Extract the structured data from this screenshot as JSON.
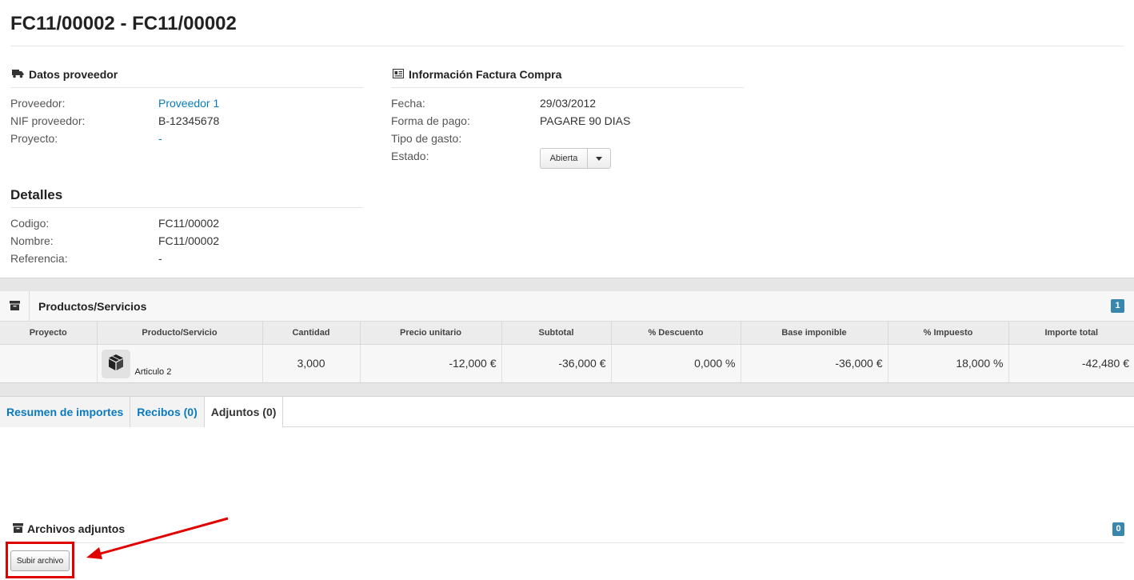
{
  "page": {
    "title": "FC11/00002 - FC11/00002"
  },
  "supplier": {
    "heading": "Datos proveedor",
    "icon": "truck-icon",
    "fields": [
      {
        "label": "Proveedor:",
        "value": "Proveedor 1",
        "link": true
      },
      {
        "label": "NIF proveedor:",
        "value": "B-12345678",
        "link": false
      },
      {
        "label": "Proyecto:",
        "value": "-",
        "link": true
      }
    ]
  },
  "invoice": {
    "heading": "Información Factura Compra",
    "icon": "id-card-icon",
    "fields": [
      {
        "label": "Fecha:",
        "value": "29/03/2012"
      },
      {
        "label": "Forma de pago:",
        "value": "PAGARE 90 DIAS"
      },
      {
        "label": "Tipo de gasto:",
        "value": ""
      },
      {
        "label": "Estado:",
        "value": ""
      }
    ],
    "status": {
      "label": "Abierta",
      "icon": "caret-down-icon"
    }
  },
  "details": {
    "heading": "Detalles",
    "fields": [
      {
        "label": "Codigo:",
        "value": "FC11/00002"
      },
      {
        "label": "Nombre:",
        "value": "FC11/00002"
      },
      {
        "label": "Referencia:",
        "value": "-"
      }
    ]
  },
  "products": {
    "heading": "Productos/Servicios",
    "icon": "archive-icon",
    "count": "1",
    "columns": [
      "Proyecto",
      "Producto/Servicio",
      "Cantidad",
      "Precio unitario",
      "Subtotal",
      "% Descuento",
      "Base imponible",
      "% Impuesto",
      "Importe total"
    ],
    "rows": [
      {
        "proyecto": "",
        "producto": "Articulo 2",
        "producto_icon": "box-icon",
        "cantidad": "3,000",
        "precio": "-12,000 €",
        "subtotal": "-36,000 €",
        "descuento": "0,000 %",
        "base": "-36,000 €",
        "impuesto": "18,000 %",
        "total": "-42,480 €"
      }
    ]
  },
  "tabs": [
    {
      "label": "Resumen de importes",
      "active": false
    },
    {
      "label": "Recibos (0)",
      "active": false
    },
    {
      "label": "Adjuntos (0)",
      "active": true
    }
  ],
  "attachments": {
    "heading": "Archivos adjuntos",
    "icon": "archive-icon",
    "count": "0",
    "upload_label": "Subir archivo"
  },
  "colors": {
    "link": "#0a7abf",
    "badge": "#3a87ad",
    "annotation": "#e00000"
  }
}
